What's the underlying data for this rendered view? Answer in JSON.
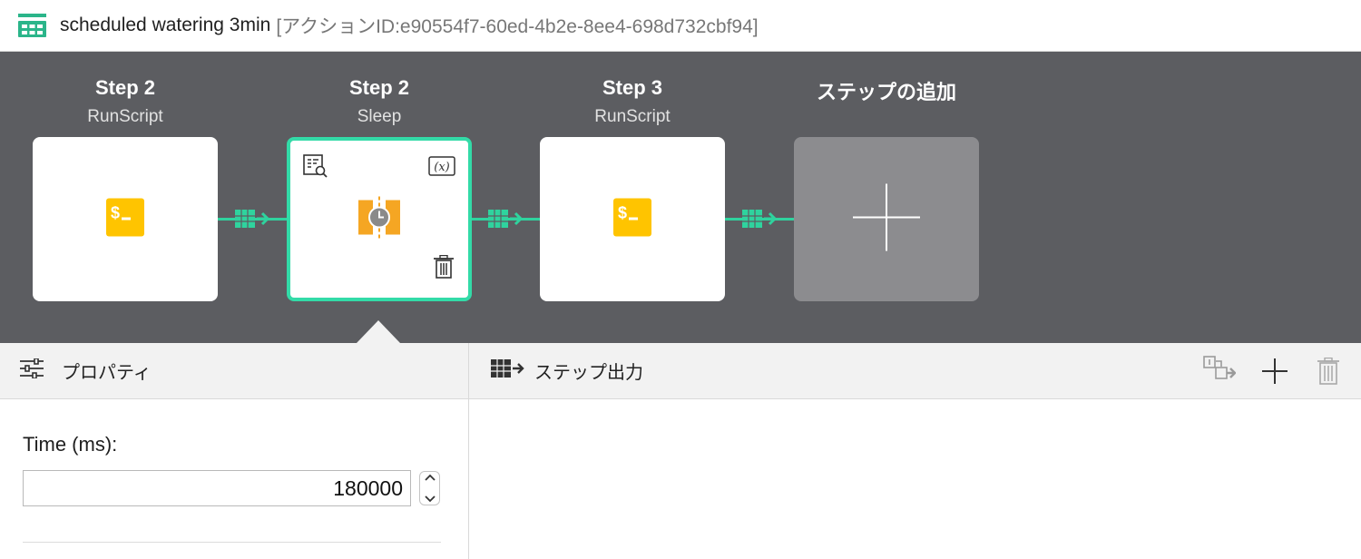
{
  "window": {
    "title": "scheduled watering 3min",
    "action_id": "[アクションID:e90554f7-60ed-4b2e-8ee4-698d732cbf94]",
    "icon": "workflow-table-icon"
  },
  "steps": [
    {
      "name": "Step 2",
      "type": "RunScript",
      "icon": "terminal-script-icon",
      "selected": false
    },
    {
      "name": "Step 2",
      "type": "Sleep",
      "icon": "sleep-clock-icon",
      "selected": true
    },
    {
      "name": "Step 3",
      "type": "RunScript",
      "icon": "terminal-script-icon",
      "selected": false
    }
  ],
  "add_step": {
    "label": "ステップの追加",
    "icon": "plus-icon"
  },
  "colors": {
    "accent": "#33dba8",
    "canvas": "#5c5d61",
    "script": "#ffc400",
    "sleep": "#f5a623"
  },
  "properties_panel": {
    "title": "プロパティ",
    "field_label": "Time (ms):",
    "field_value": "180000"
  },
  "output_panel": {
    "title": "ステップ出力"
  }
}
